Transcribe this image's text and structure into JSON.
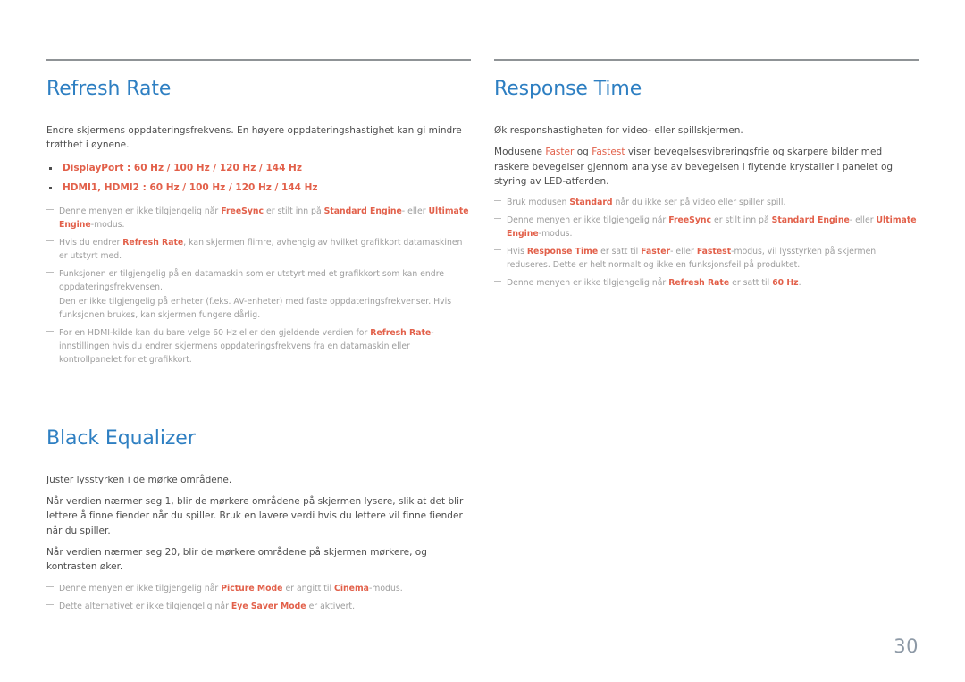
{
  "page": {
    "number": "30"
  },
  "left_column": {
    "sections": [
      {
        "title": "Refresh Rate",
        "has_rule": true,
        "intro": "Endre skjermens oppdateringsfrekvens. En høyere oppdateringshastighet kan gi mindre trøtthet i øynene.",
        "bullets": [
          "DisplayPort : 60 Hz / 100 Hz / 120 Hz / 144 Hz",
          "HDMI1, HDMI2 : 60 Hz / 100 Hz / 120 Hz / 144 Hz"
        ],
        "notes": [
          {
            "parts": [
              {
                "t": "Denne menyen er ikke tilgjengelig når ",
                "s": "plain"
              },
              {
                "t": "FreeSync",
                "s": "hl"
              },
              {
                "t": " er stilt inn på ",
                "s": "plain"
              },
              {
                "t": "Standard Engine",
                "s": "hl"
              },
              {
                "t": "- eller ",
                "s": "plain"
              },
              {
                "t": "Ultimate Engine",
                "s": "hl"
              },
              {
                "t": "-modus.",
                "s": "plain"
              }
            ]
          },
          {
            "parts": [
              {
                "t": "Hvis du endrer ",
                "s": "plain"
              },
              {
                "t": "Refresh Rate",
                "s": "hl"
              },
              {
                "t": ", kan skjermen flimre, avhengig av hvilket grafikkort datamaskinen er utstyrt med.",
                "s": "plain"
              }
            ]
          },
          {
            "parts": [
              {
                "t": "Funksjonen er tilgjengelig på en datamaskin som er utstyrt med et grafikkort som kan endre oppdateringsfrekvensen.",
                "s": "plain"
              },
              {
                "t": "",
                "s": "br"
              },
              {
                "t": "Den er ikke tilgjengelig på enheter (f.eks. AV-enheter) med faste oppdateringsfrekvenser. Hvis funksjonen brukes, kan skjermen fungere dårlig.",
                "s": "plain"
              }
            ]
          },
          {
            "parts": [
              {
                "t": "For en HDMI-kilde kan du bare velge 60 Hz eller den gjeldende verdien for ",
                "s": "plain"
              },
              {
                "t": "Refresh Rate",
                "s": "hl"
              },
              {
                "t": "-innstillingen hvis du endrer skjermens oppdateringsfrekvens fra en datamaskin eller kontrollpanelet for et grafikkort.",
                "s": "plain"
              }
            ]
          }
        ]
      },
      {
        "title": "Black Equalizer",
        "has_rule": false,
        "paragraphs": [
          "Juster lysstyrken i de mørke områdene.",
          "Når verdien nærmer seg 1, blir de mørkere områdene på skjermen lysere, slik at det blir lettere å finne fiender når du spiller. Bruk en lavere verdi hvis du lettere vil finne fiender når du spiller.",
          "Når verdien nærmer seg 20, blir de mørkere områdene på skjermen mørkere, og kontrasten øker."
        ],
        "notes": [
          {
            "parts": [
              {
                "t": "Denne menyen er ikke tilgjengelig når ",
                "s": "plain"
              },
              {
                "t": "Picture Mode",
                "s": "hl"
              },
              {
                "t": " er angitt til ",
                "s": "plain"
              },
              {
                "t": "Cinema",
                "s": "hl"
              },
              {
                "t": "-modus.",
                "s": "plain"
              }
            ]
          },
          {
            "parts": [
              {
                "t": "Dette alternativet er ikke tilgjengelig når ",
                "s": "plain"
              },
              {
                "t": "Eye Saver Mode",
                "s": "hl"
              },
              {
                "t": " er aktivert.",
                "s": "plain"
              }
            ]
          }
        ]
      }
    ]
  },
  "right_column": {
    "sections": [
      {
        "title": "Response Time",
        "has_rule": true,
        "paragraphs_rich": [
          [
            {
              "t": "Øk responshastigheten for video- eller spillskjermen.",
              "s": "plain"
            }
          ],
          [
            {
              "t": "Modusene ",
              "s": "plain"
            },
            {
              "t": "Faster",
              "s": "hl-reg"
            },
            {
              "t": " og ",
              "s": "plain"
            },
            {
              "t": "Fastest",
              "s": "hl-reg"
            },
            {
              "t": " viser bevegelsesvibreringsfrie og skarpere bilder med raskere bevegelser gjennom analyse av bevegelsen i flytende krystaller i panelet og styring av LED-atferden.",
              "s": "plain"
            }
          ]
        ],
        "notes": [
          {
            "parts": [
              {
                "t": "Bruk modusen ",
                "s": "plain"
              },
              {
                "t": "Standard",
                "s": "hl"
              },
              {
                "t": " når du ikke ser på video eller spiller spill.",
                "s": "plain"
              }
            ]
          },
          {
            "parts": [
              {
                "t": "Denne menyen er ikke tilgjengelig når ",
                "s": "plain"
              },
              {
                "t": "FreeSync",
                "s": "hl"
              },
              {
                "t": " er stilt inn på ",
                "s": "plain"
              },
              {
                "t": "Standard Engine",
                "s": "hl"
              },
              {
                "t": "- eller ",
                "s": "plain"
              },
              {
                "t": "Ultimate Engine",
                "s": "hl"
              },
              {
                "t": "-modus.",
                "s": "plain"
              }
            ]
          },
          {
            "parts": [
              {
                "t": "Hvis ",
                "s": "plain"
              },
              {
                "t": "Response Time",
                "s": "hl"
              },
              {
                "t": " er satt til ",
                "s": "plain"
              },
              {
                "t": "Faster",
                "s": "hl"
              },
              {
                "t": "- eller ",
                "s": "plain"
              },
              {
                "t": "Fastest",
                "s": "hl"
              },
              {
                "t": "-modus, vil lysstyrken på skjermen reduseres. Dette er helt normalt og ikke en funksjonsfeil på produktet.",
                "s": "plain"
              }
            ]
          },
          {
            "parts": [
              {
                "t": "Denne menyen er ikke tilgjengelig når ",
                "s": "plain"
              },
              {
                "t": "Refresh Rate",
                "s": "hl"
              },
              {
                "t": " er satt til ",
                "s": "plain"
              },
              {
                "t": "60 Hz",
                "s": "hl"
              },
              {
                "t": ".",
                "s": "plain"
              }
            ]
          }
        ]
      }
    ]
  },
  "colors": {
    "heading_blue": "#2e7fc2",
    "highlight_orange": "#e2604a",
    "body_gray": "#4d4d4d",
    "note_gray": "#9d9d9d",
    "rule_gray": "#8f9396",
    "page_number_gray": "#8d99a6"
  }
}
